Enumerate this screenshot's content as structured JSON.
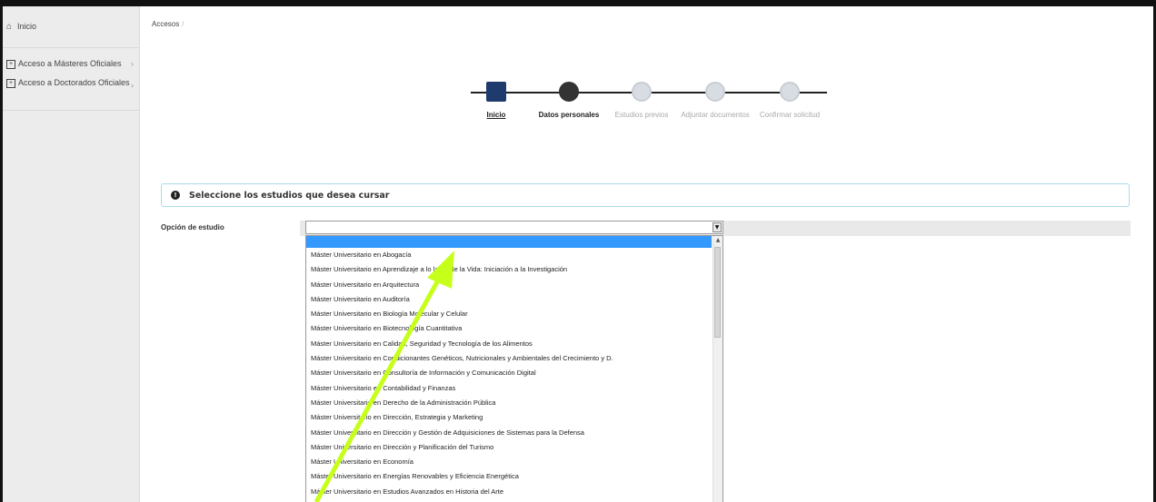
{
  "sidebar": {
    "home_label": "Inicio",
    "items": [
      {
        "label": "Acceso a Másteres Oficiales"
      },
      {
        "label": "Acceso a Doctorados Oficiales"
      }
    ]
  },
  "breadcrumb": {
    "label": "Accesos"
  },
  "stepper": {
    "steps": [
      {
        "label": "Inicio",
        "state": "active"
      },
      {
        "label": "Datos personales",
        "state": "completed"
      },
      {
        "label": "Estudios previos",
        "state": "pending"
      },
      {
        "label": "Adjuntar documentos",
        "state": "pending"
      },
      {
        "label": "Confirmar solicitud",
        "state": "pending"
      }
    ]
  },
  "alert": {
    "text": "Seleccione los estudios que desea cursar"
  },
  "form": {
    "field_label": "Opción de estudio",
    "selected_value": "",
    "options": [
      "Máster Universitario en Abogacía",
      "Máster Universitario en Aprendizaje a lo largo de la Vida: Iniciación a la Investigación",
      "Máster Universitario en Arquitectura",
      "Máster Universitario en Auditoría",
      "Máster Universitario en Biología Molecular y Celular",
      "Máster Universitario en Biotecnología Cuantitativa",
      "Máster Universitario en Calidad, Seguridad y Tecnología de los Alimentos",
      "Máster Universitario en Condicionantes Genéticos, Nutricionales y Ambientales del Crecimiento y D.",
      "Máster Universitario en Consultoría de Información y Comunicación Digital",
      "Máster Universitario en Contabilidad y Finanzas",
      "Máster Universitario en Derecho de la Administración Pública",
      "Máster Universitario en Dirección, Estrategia y Marketing",
      "Máster Universitario en Dirección y Gestión de Adquisiciones de Sistemas para la Defensa",
      "Máster Universitario en Dirección y Planificación del Turismo",
      "Máster Universitario en Economía",
      "Máster Universitario en Energías Renovables y Eficiencia Energética",
      "Máster Universitario en Estudios Avanzados en Historia del Arte"
    ]
  },
  "colors": {
    "accent": "#1f3a6d",
    "selection": "#3399ff",
    "annotation_arrow": "#c6ff1a"
  },
  "icons": {
    "home": "home-icon",
    "plus_box": "plus-box-icon",
    "info": "info-icon"
  }
}
